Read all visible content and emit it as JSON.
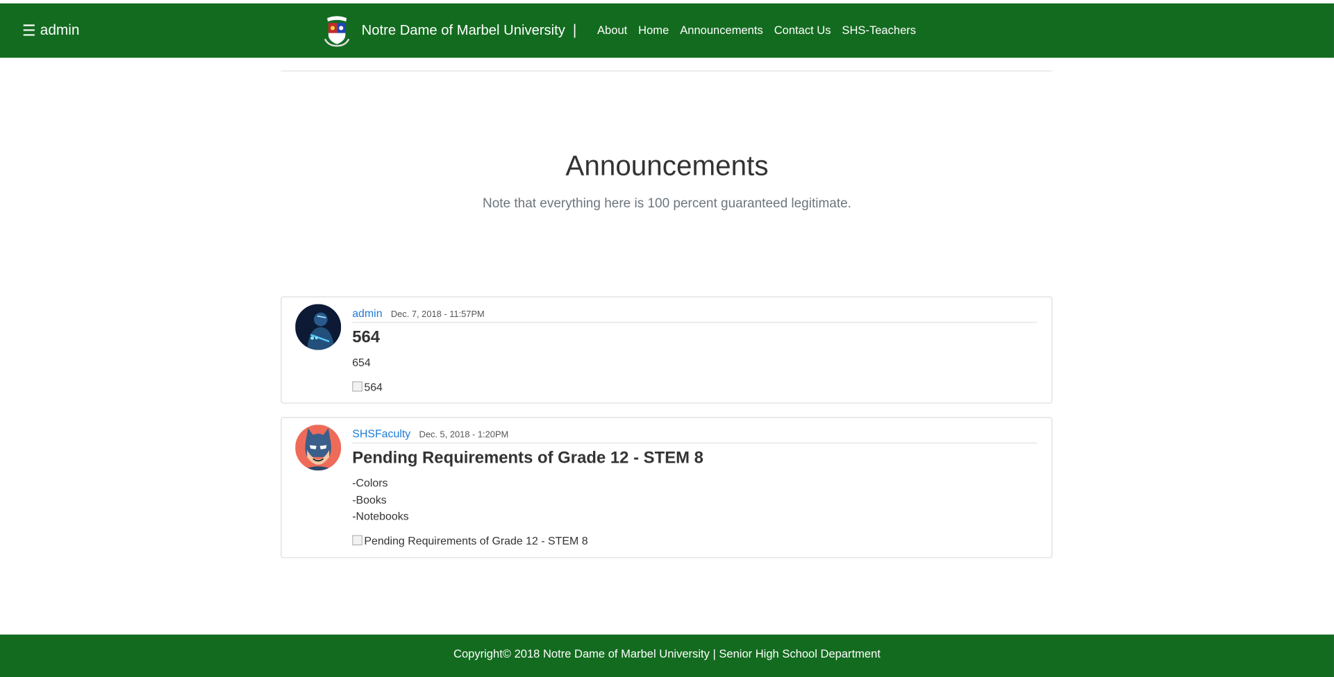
{
  "navbar": {
    "menu_icon": "☰",
    "menu_label": "admin",
    "brand": "Notre Dame of Marbel University",
    "separator": "|",
    "links": [
      "About",
      "Home",
      "Announcements",
      "Contact Us",
      "SHS-Teachers"
    ],
    "bg_color": "#136b1f"
  },
  "hero": {
    "title": "Announcements",
    "subtitle": "Note that everything here is 100 percent guaranteed legitimate."
  },
  "posts": [
    {
      "author": "admin",
      "date": "Dec. 7, 2018 - 11:57PM",
      "title": "564",
      "body_lines": [
        "654"
      ],
      "image_alt": "564"
    },
    {
      "author": "SHSFaculty",
      "date": "Dec. 5, 2018 - 1:20PM",
      "title": "Pending Requirements of Grade 12 - STEM 8",
      "body_lines": [
        "-Colors",
        "-Books",
        "-Notebooks"
      ],
      "image_alt": "Pending Requirements of Grade 12 - STEM 8"
    }
  ],
  "footer": {
    "text": "Copyright© 2018 Notre Dame of Marbel University | Senior High School Department"
  },
  "colors": {
    "green": "#136b1f",
    "link_blue": "#1d7bd6"
  }
}
